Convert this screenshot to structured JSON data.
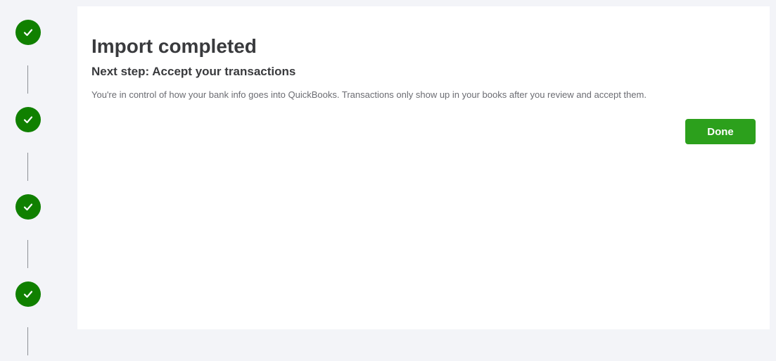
{
  "stepper": {
    "steps": [
      {
        "status": "completed",
        "icon": "check-icon"
      },
      {
        "status": "completed",
        "icon": "check-icon"
      },
      {
        "status": "completed",
        "icon": "check-icon"
      },
      {
        "status": "completed",
        "icon": "check-icon"
      }
    ],
    "complete_color": "#108000"
  },
  "card": {
    "title": "Import completed",
    "subtitle": "Next step: Accept your transactions",
    "description": "You're in control of how your bank info goes into QuickBooks. Transactions only show up in your books after you review and accept them.",
    "done_label": "Done",
    "button_color": "#2ca01c"
  }
}
